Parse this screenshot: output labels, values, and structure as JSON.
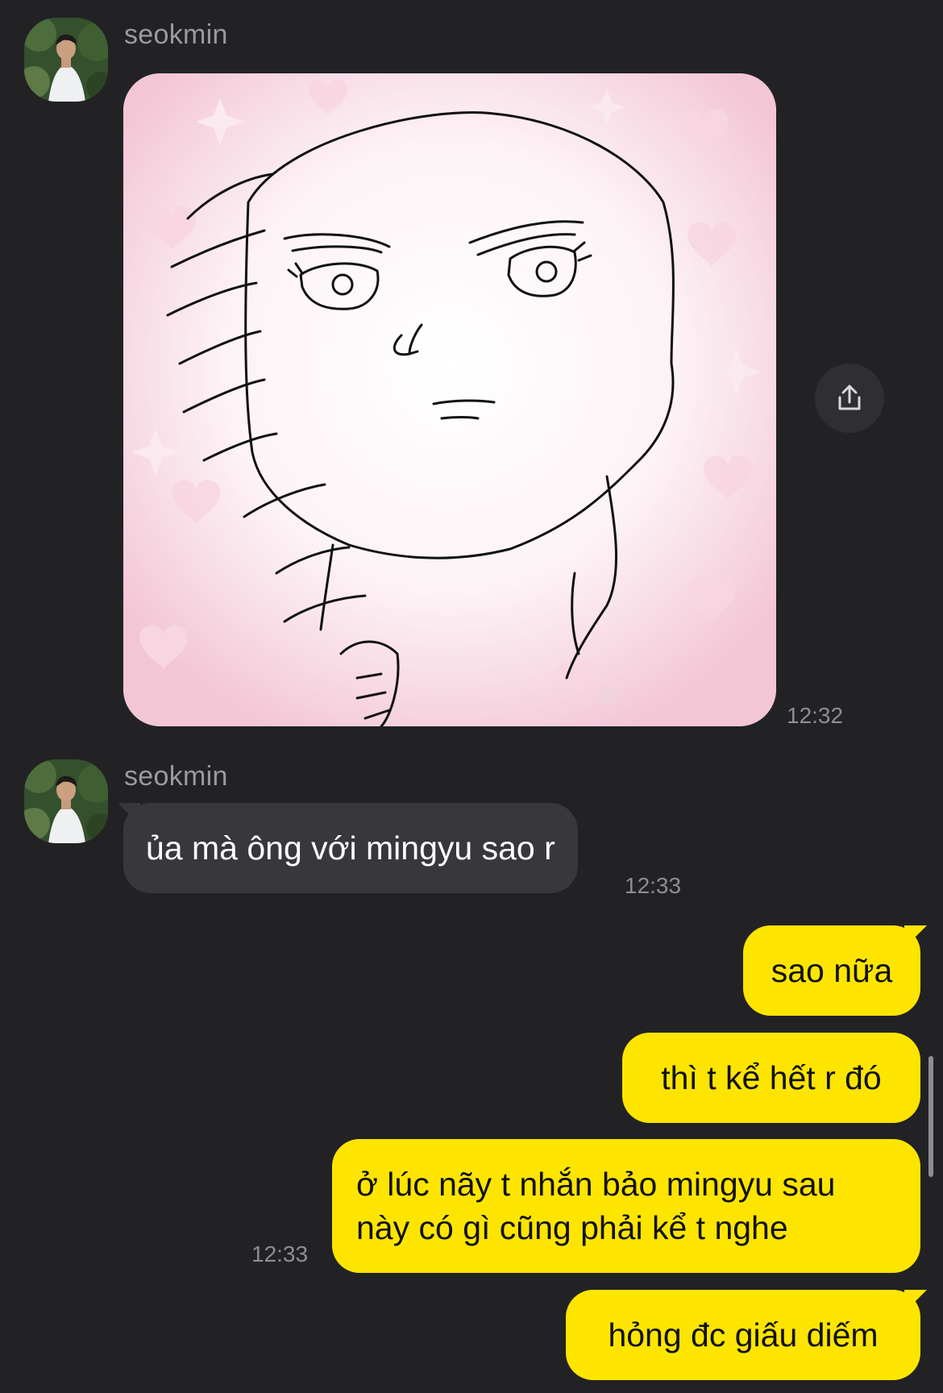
{
  "chat": {
    "messages": [
      {
        "id": "m1",
        "direction": "incoming",
        "sender": "seokmin",
        "type": "image",
        "image_watermark": "@",
        "time": "12:32"
      },
      {
        "id": "m2",
        "direction": "incoming",
        "sender": "seokmin",
        "type": "text",
        "text": "ủa mà ông với mingyu sao r",
        "time": "12:33"
      },
      {
        "id": "m3",
        "direction": "outgoing",
        "type": "text",
        "text": "sao nữa"
      },
      {
        "id": "m4",
        "direction": "outgoing",
        "type": "text",
        "text": "thì t kể hết r đó"
      },
      {
        "id": "m5",
        "direction": "outgoing",
        "type": "text",
        "text": "ở lúc nãy t nhắn bảo mingyu sau\nnày có gì cũng phải kể t nghe",
        "time": "12:33"
      },
      {
        "id": "m6",
        "direction": "outgoing",
        "type": "text",
        "text": "hỏng đc giấu diếm"
      }
    ],
    "icons": {
      "share": "share-icon",
      "avatar": "avatar-icon"
    }
  },
  "colors": {
    "background": "#222225",
    "incoming_bubble": "#38383c",
    "outgoing_bubble": "#fde500",
    "outgoing_text": "#111111",
    "timestamp": "#8d8d92",
    "sender_name": "#9a9a9f"
  }
}
